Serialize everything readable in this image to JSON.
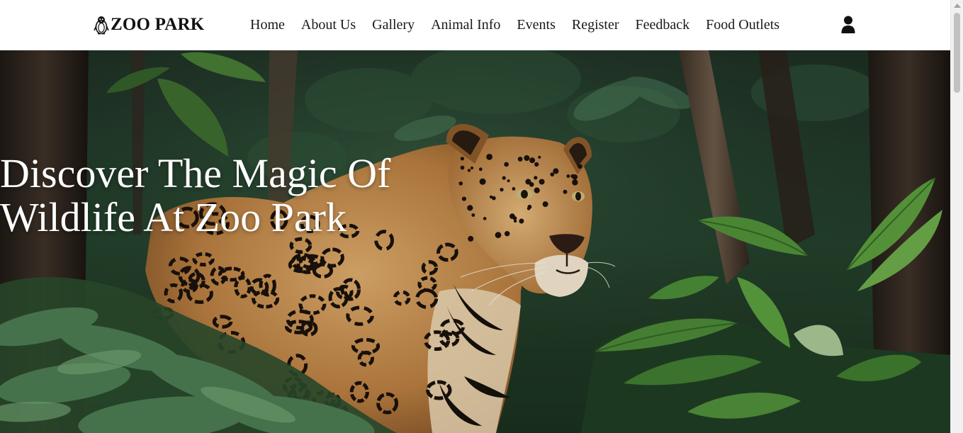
{
  "brand": {
    "name": "ZOO PARK",
    "icon": "penguin-icon"
  },
  "nav": {
    "links": [
      {
        "label": "Home"
      },
      {
        "label": "About Us"
      },
      {
        "label": "Gallery"
      },
      {
        "label": "Animal Info"
      },
      {
        "label": "Events"
      },
      {
        "label": "Register"
      },
      {
        "label": "Feedback"
      },
      {
        "label": "Food Outlets"
      }
    ],
    "user_icon": "user-icon"
  },
  "hero": {
    "title": "Discover The Magic Of Wildlife At Zoo Park",
    "image": "jaguar-in-jungle-photo"
  },
  "colors": {
    "navbar_bg": "#ffffff",
    "nav_text": "#1a1a1a",
    "hero_title": "#ffffff",
    "jungle_dark": "#1d3223"
  },
  "scrollbar": {
    "position_fraction": 0.0
  }
}
